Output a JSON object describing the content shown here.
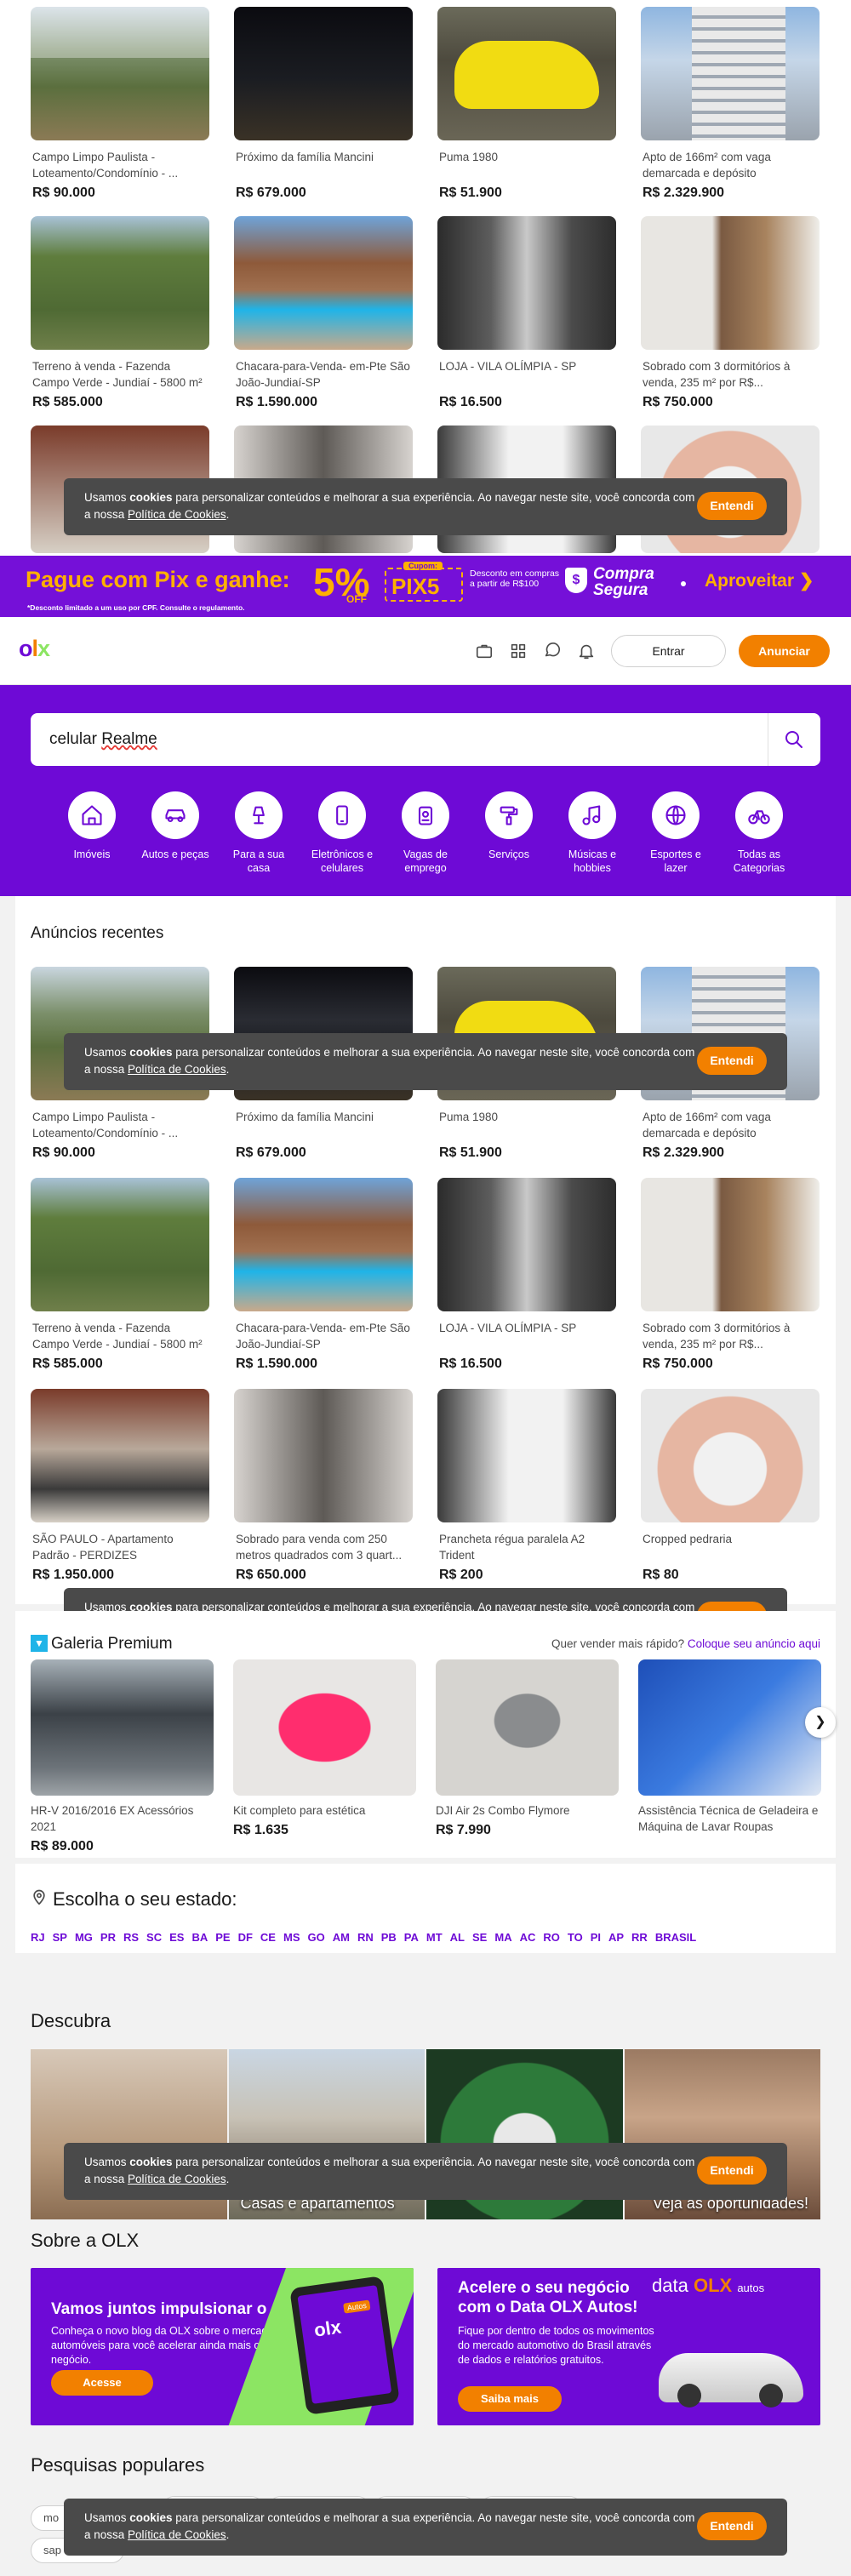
{
  "top_listings": [
    {
      "title": "Campo Limpo Paulista - Loteamento/Condomínio - ...",
      "price": "R$ 90.000"
    },
    {
      "title": "Próximo da família Mancini",
      "price": "R$ 679.000"
    },
    {
      "title": "Puma 1980",
      "price": "R$ 51.900"
    },
    {
      "title": "Apto de 166m² com vaga demarcada e depósito",
      "price": "R$ 2.329.900"
    },
    {
      "title": "Terreno à venda - Fazenda Campo Verde - Jundiaí - 5800 m²",
      "price": "R$ 585.000"
    },
    {
      "title": "Chacara-para-Venda- em-Pte São João-Jundiaí-SP",
      "price": "R$ 1.590.000"
    },
    {
      "title": "LOJA - VILA OLÍMPIA - SP",
      "price": "R$ 16.500"
    },
    {
      "title": "Sobrado com 3 dormitórios à venda, 235 m² por R$...",
      "price": "R$ 750.000"
    }
  ],
  "cookie": {
    "text_before": "Usamos ",
    "text_bold": "cookies",
    "text_after": " para personalizar conteúdos e melhorar a sua experiência. Ao navegar neste site, você concorda com a nossa ",
    "link": "Política de Cookies",
    "end": ".",
    "button": "Entendi"
  },
  "promo": {
    "headline": "Pague com Pix e ganhe:",
    "percent": "5%",
    "off": "OFF",
    "cupom_label": "Cupom:",
    "code": "PIX5",
    "desc": "Desconto em compras a partir de R$100",
    "safe_line1": "Compra",
    "safe_line2": "Segura",
    "cta": "Aproveitar",
    "footnote": "*Desconto limitado a um uso por CPF. Consulte o regulamento."
  },
  "header": {
    "logo_o": "o",
    "logo_l": "l",
    "logo_x": "x",
    "login": "Entrar",
    "announce": "Anunciar"
  },
  "search": {
    "value_prefix": "celular ",
    "value_brand": "Realme"
  },
  "categories": [
    {
      "label": "Imóveis",
      "icon": "home-icon"
    },
    {
      "label": "Autos e peças",
      "icon": "car-icon"
    },
    {
      "label": "Para a sua casa",
      "icon": "lamp-icon"
    },
    {
      "label": "Eletrônicos e celulares",
      "icon": "phone-icon"
    },
    {
      "label": "Vagas de emprego",
      "icon": "badge-icon"
    },
    {
      "label": "Serviços",
      "icon": "paint-roller-icon"
    },
    {
      "label": "Músicas e hobbies",
      "icon": "music-note-icon"
    },
    {
      "label": "Esportes e lazer",
      "icon": "ball-icon"
    },
    {
      "label": "Todas as Categorias",
      "icon": "bicycle-icon"
    }
  ],
  "recent": {
    "title": "Anúncios recentes",
    "third_row": [
      {
        "title": "SÃO PAULO - Apartamento Padrão - PERDIZES",
        "price": "R$ 1.950.000"
      },
      {
        "title": "Sobrado para venda com 250 metros quadrados com 3 quart...",
        "price": "R$ 650.000"
      },
      {
        "title": "Prancheta régua paralela A2 Trident",
        "price": "R$ 200"
      },
      {
        "title": "Cropped pedraria",
        "price": "R$ 80"
      }
    ]
  },
  "gallery": {
    "title": "Galeria Premium",
    "sell_prompt": "Quer vender mais rápido?",
    "sell_link": "Coloque seu anúncio aqui",
    "items": [
      {
        "title": "HR-V 2016/2016 EX Acessórios 2021",
        "price": "R$ 89.000"
      },
      {
        "title": "Kit completo para estética",
        "price": "R$ 1.635"
      },
      {
        "title": "DJI Air 2s Combo Flymore",
        "price": "R$ 7.990"
      },
      {
        "title": "Assistência Técnica de Geladeira e Máquina de Lavar Roupas",
        "price": ""
      }
    ]
  },
  "states": {
    "title": "Escolha o seu estado:",
    "list": [
      "RJ",
      "SP",
      "MG",
      "PR",
      "RS",
      "SC",
      "ES",
      "BA",
      "PE",
      "DF",
      "CE",
      "MS",
      "GO",
      "AM",
      "RN",
      "PB",
      "PA",
      "MT",
      "AL",
      "SE",
      "MA",
      "AC",
      "RO",
      "TO",
      "PI",
      "AP",
      "RR",
      "BRASIL"
    ]
  },
  "discover": {
    "title": "Descubra",
    "captions": [
      "",
      "Casas e apartamentos",
      "",
      "Veja as oportunidades!"
    ]
  },
  "about": {
    "title": "Sobre a OLX",
    "card1": {
      "title": "Vamos juntos impulsionar o seu negócio?",
      "text": "Conheça o novo blog da OLX sobre o mercado de automóveis para você acelerar ainda mais o seu negócio.",
      "button": "Acesse",
      "tag": "olx",
      "tag2": "Autos"
    },
    "card2": {
      "title": "Acelere o seu negócio com o Data OLX Autos!",
      "text": "Fique por dentro de todos os movimentos do mercado automotivo do Brasil através de dados e relatórios gratuitos.",
      "button": "Saiba mais",
      "brand_data": "data",
      "brand_olx": "OLX",
      "brand_autos": "autos"
    }
  },
  "popular": {
    "title": "Pesquisas populares",
    "chips": [
      "mo",
      "",
      "",
      "",
      "",
      "sap"
    ]
  },
  "colors": {
    "purple": "#6e0ad6",
    "orange": "#f28000",
    "olx_green": "#8ce563",
    "cookie_bg": "#4a4a4a"
  }
}
